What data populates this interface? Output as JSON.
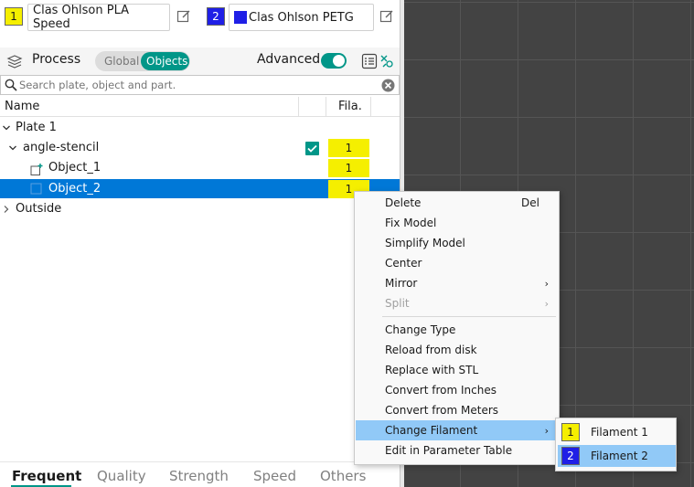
{
  "filaments": [
    {
      "index": "1",
      "name": "Clas Ohlson PLA Speed",
      "color": "#f5ef00"
    },
    {
      "index": "2",
      "name": "Clas Ohlson PETG",
      "color": "#1f1fe6"
    }
  ],
  "process": {
    "label": "Process",
    "toggle": {
      "global": "Global",
      "objects": "Objects",
      "selected": "Objects"
    },
    "advanced_label": "Advanced",
    "advanced_on": true
  },
  "search": {
    "placeholder": "Search plate, object and part."
  },
  "tree": {
    "col_name": "Name",
    "col_fila": "Fila.",
    "rows": [
      {
        "label": "Plate 1",
        "type": "plate",
        "expanded": true
      },
      {
        "label": "angle-stencil",
        "type": "object",
        "fila": "1",
        "checked": true
      },
      {
        "label": "Object_1",
        "type": "part",
        "fila": "1"
      },
      {
        "label": "Object_2",
        "type": "part",
        "fila": "1",
        "selected": true
      },
      {
        "label": "Outside",
        "type": "plate",
        "expanded": false
      }
    ]
  },
  "context_menu": {
    "items": [
      {
        "label": "Delete",
        "accel": "Del"
      },
      {
        "label": "Fix Model"
      },
      {
        "label": "Simplify Model"
      },
      {
        "label": "Center"
      },
      {
        "label": "Mirror",
        "submenu": true
      },
      {
        "label": "Split",
        "submenu": true,
        "disabled": true
      },
      {
        "label": "Change Type"
      },
      {
        "label": "Reload from disk"
      },
      {
        "label": "Replace with STL"
      },
      {
        "label": "Convert from Inches"
      },
      {
        "label": "Convert from Meters"
      },
      {
        "label": "Change Filament",
        "submenu": true,
        "highlighted": true
      },
      {
        "label": "Edit in Parameter Table"
      }
    ],
    "submenu_change_filament": [
      {
        "index": "1",
        "label": "Filament 1",
        "color": "#f5ef00"
      },
      {
        "index": "2",
        "label": "Filament 2",
        "color": "#1f1fe6",
        "highlighted": true
      }
    ]
  },
  "bottom_tabs": [
    {
      "label": "Frequent",
      "active": true
    },
    {
      "label": "Quality"
    },
    {
      "label": "Strength"
    },
    {
      "label": "Speed"
    },
    {
      "label": "Others"
    }
  ],
  "colors": {
    "accent": "#009688",
    "selection": "#0078d7",
    "menu_highlight": "#91c9f7",
    "viewport_bg": "#434343"
  }
}
